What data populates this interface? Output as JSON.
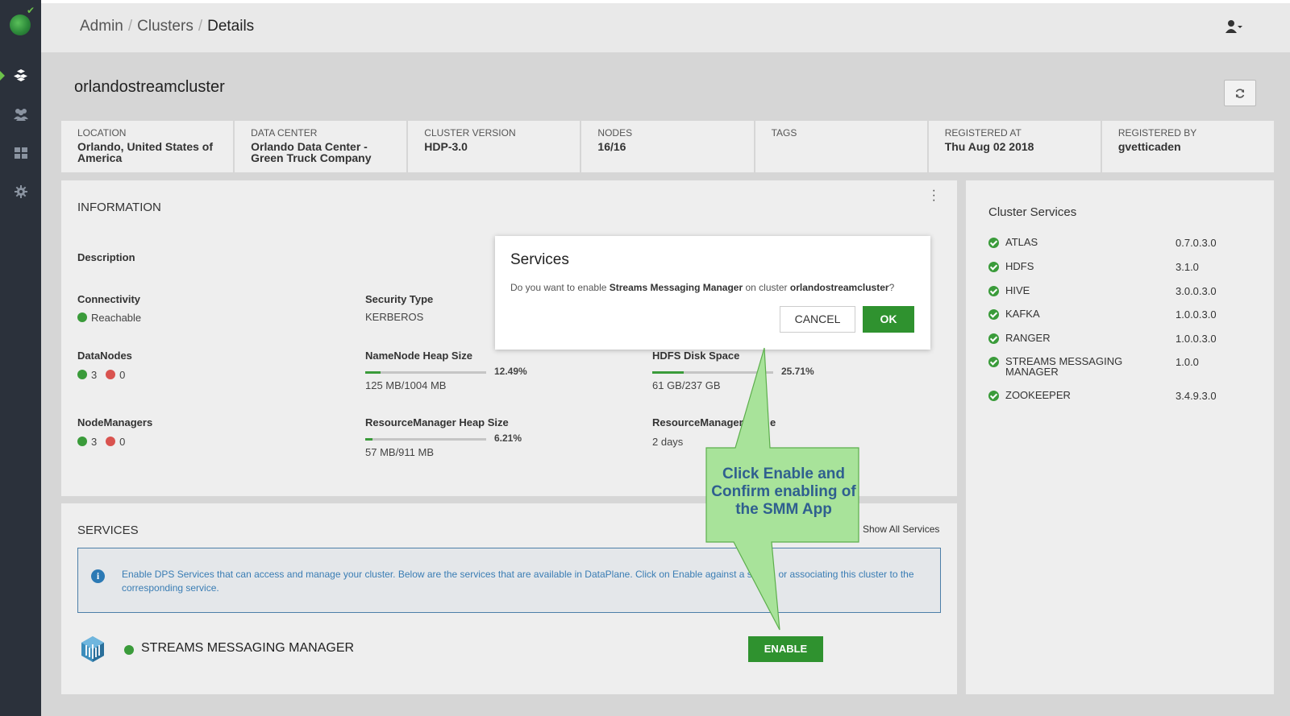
{
  "breadcrumb": {
    "admin": "Admin",
    "clusters": "Clusters",
    "current": "Details",
    "separator": "/"
  },
  "cluster": {
    "name": "orlandostreamcluster"
  },
  "strip": [
    {
      "label": "LOCATION",
      "value": "Orlando, United States of America"
    },
    {
      "label": "DATA CENTER",
      "value": "Orlando Data Center - Green Truck Company"
    },
    {
      "label": "CLUSTER VERSION",
      "value": "HDP-3.0"
    },
    {
      "label": "NODES",
      "value": "16/16"
    },
    {
      "label": "TAGS",
      "value": ""
    },
    {
      "label": "REGISTERED AT",
      "value": "Thu Aug 02 2018"
    },
    {
      "label": "REGISTERED BY",
      "value": "gvetticaden"
    }
  ],
  "information": {
    "title": "INFORMATION",
    "description_label": "Description",
    "connectivity_label": "Connectivity",
    "connectivity_value": "Reachable",
    "security_label": "Security Type",
    "security_value": "KERBEROS",
    "datanodes_label": "DataNodes",
    "datanodes_up": "3",
    "datanodes_down": "0",
    "namenode_label": "NameNode Heap Size",
    "namenode_pct": "12.49%",
    "namenode_fraction": 0.1249,
    "namenode_value": "125 MB/1004 MB",
    "hdfs_label": "HDFS Disk Space",
    "hdfs_pct": "25.71%",
    "hdfs_fraction": 0.2571,
    "hdfs_value": "61 GB/237 GB",
    "nodemanagers_label": "NodeManagers",
    "nodemanagers_up": "3",
    "nodemanagers_down": "0",
    "rm_heap_label": "ResourceManager Heap Size",
    "rm_heap_pct": "6.21%",
    "rm_heap_fraction": 0.0621,
    "rm_heap_value": "57 MB/911 MB",
    "rm_uptime_label_a": "ResourceManager",
    "rm_uptime_label_b": "e",
    "rm_uptime_value": "2 days"
  },
  "cluster_services": {
    "title": "Cluster Services",
    "items": [
      {
        "name": "ATLAS",
        "version": "0.7.0.3.0"
      },
      {
        "name": "HDFS",
        "version": "3.1.0"
      },
      {
        "name": "HIVE",
        "version": "3.0.0.3.0"
      },
      {
        "name": "KAFKA",
        "version": "1.0.0.3.0"
      },
      {
        "name": "RANGER",
        "version": "1.0.0.3.0"
      },
      {
        "name": "STREAMS MESSAGING MANAGER",
        "version": "1.0.0"
      },
      {
        "name": "ZOOKEEPER",
        "version": "3.4.9.3.0"
      }
    ]
  },
  "services": {
    "title": "SERVICES",
    "show_all": "Show All Services",
    "info_text_a": "Enable DPS Services that can access and manage your cluster. Below are the services that are available in DataPlane. Click on Enable against a se",
    "info_text_b": "or associating this cluster to the corresponding service.",
    "service_name": "STREAMS MESSAGING MANAGER",
    "enable_label": "ENABLE"
  },
  "modal": {
    "title": "Services",
    "text_prefix": "Do you want to enable ",
    "service_bold": "Streams Messaging Manager",
    "text_mid": " on cluster ",
    "cluster_bold": "orlandostreamcluster",
    "text_suffix": "?",
    "cancel_label": "CANCEL",
    "ok_label": "OK"
  },
  "callout": {
    "text": "Click Enable and Confirm enabling of the SMM App"
  },
  "colors": {
    "sidebar": "#2b313b",
    "accent_green": "#2f922f",
    "info_blue": "#3a7db4",
    "callout_fill": "#a8e39a"
  }
}
